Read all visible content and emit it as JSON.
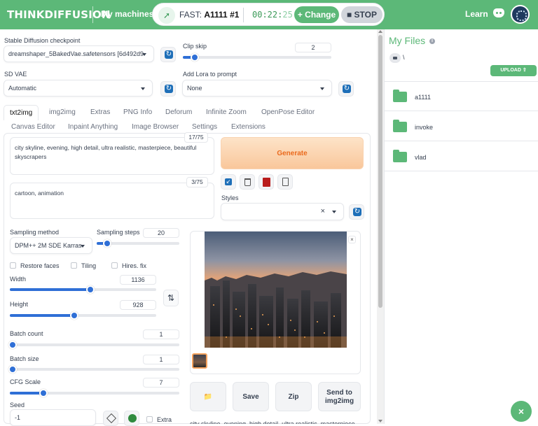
{
  "topbar": {
    "brand_left": "THINK",
    "brand_right": "DIFFUSION",
    "my_machines": "My machines",
    "rocket_icon": "rocket-icon",
    "fast_prefix": "FAST:",
    "fast_name": "A1111 #1",
    "timer_main": "00:22:",
    "timer_secs": "25",
    "change_label": "+ Change",
    "stop_label": "■ STOP",
    "learn": "Learn",
    "accent": "#5cb878"
  },
  "webui": {
    "checkpoint_label": "Stable Diffusion checkpoint",
    "checkpoint_value": "dreamshaper_5BakedVae.safetensors [6d492d9",
    "clip_skip_label": "Clip skip",
    "clip_skip_value": "2",
    "clip_skip_fraction": 0.08,
    "vae_label": "SD VAE",
    "vae_value": "Automatic",
    "lora_label": "Add Lora to prompt",
    "lora_value": "None",
    "tabs_row1": [
      "txt2img",
      "img2img",
      "Extras",
      "PNG Info",
      "Deforum",
      "Infinite Zoom",
      "OpenPose Editor"
    ],
    "tabs_row2": [
      "Canvas Editor",
      "Inpaint Anything",
      "Image Browser",
      "Settings",
      "Extensions"
    ],
    "prompt": "city skyline, evening, high detail, ultra realistic, masterpiece, beautiful skyscrapers",
    "prompt_count": "17/75",
    "negative_prompt": "cartoon, animation",
    "negative_count": "3/75",
    "generate_label": "Generate",
    "styles_label": "Styles",
    "styles_clear": "×",
    "sampling_method_label": "Sampling method",
    "sampling_method_value": "DPM++ 2M SDE Karras",
    "sampling_steps_label": "Sampling steps",
    "sampling_steps_value": "20",
    "sampling_steps_fraction": 0.13,
    "restore_faces": "Restore faces",
    "tiling": "Tiling",
    "hires_fix": "Hires. fix",
    "width_label": "Width",
    "width_value": "1136",
    "width_fraction": 0.55,
    "height_label": "Height",
    "height_value": "928",
    "height_fraction": 0.44,
    "swap_icon": "⇅",
    "batch_count_label": "Batch count",
    "batch_count_value": "1",
    "batch_count_fraction": 0.0,
    "batch_size_label": "Batch size",
    "batch_size_value": "1",
    "batch_size_fraction": 0.0,
    "cfg_label": "CFG Scale",
    "cfg_value": "7",
    "cfg_fraction": 0.2,
    "seed_label": "Seed",
    "seed_value": "-1",
    "extra_label": "Extra",
    "close_icon": "×",
    "folder_icon": "📁",
    "save_label": "Save",
    "zip_label": "Zip",
    "send_line1": "Send to",
    "send_line2": "img2img",
    "caption_partial": "city skyline, evening, high detail, ultra realistic, masterpiece"
  },
  "files": {
    "title": "My Files",
    "info_icon": "i",
    "path": "\\",
    "upload_label": "UPLOAD ⇧",
    "folders": [
      "a1111",
      "invoke",
      "vlad"
    ],
    "fab_icon": "×"
  }
}
